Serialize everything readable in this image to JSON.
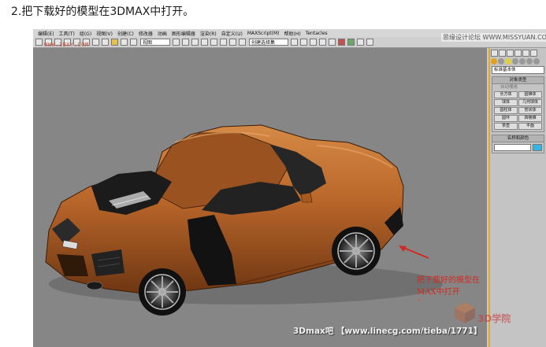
{
  "caption": "2.把下载好的模型在3DMAX中打开。",
  "menu": [
    "编辑(E)",
    "工具(T)",
    "组(G)",
    "视图(V)",
    "创建(C)",
    "修改器",
    "动画",
    "图形编辑器",
    "渲染(R)",
    "自定义(U)",
    "MAXScript(M)",
    "帮助(H)",
    "Tentacles"
  ],
  "toolbar": {
    "view_select": "视图",
    "selection_set": "创建选择集"
  },
  "forum_watermark": "思缘设计论坛 WWW.MISSYUAN.COM",
  "top_watermark": "WWW.3DXY.COM",
  "command_panel": {
    "category_dropdown": "标准基本体",
    "object_type_title": "对象类型",
    "autogrid": "自动栅格",
    "primitives": [
      "长方体",
      "圆锥体",
      "球体",
      "几何球体",
      "圆柱体",
      "管状体",
      "圆环",
      "四棱锥",
      "茶壶",
      "平面"
    ],
    "name_color_title": "名称和颜色",
    "object_color": "#31b6e6"
  },
  "annotation": {
    "text": "把下载好的模型在MAX中打开",
    "color": "#d12a22"
  },
  "bottom_watermark": "3Dmax吧 【www.linecg.com/tieba/1771】",
  "logo_watermark": "3D学院",
  "colors": {
    "viewport_bg": "#868686",
    "car_body": "#b9662a",
    "panel_accent": "#e2a923"
  }
}
